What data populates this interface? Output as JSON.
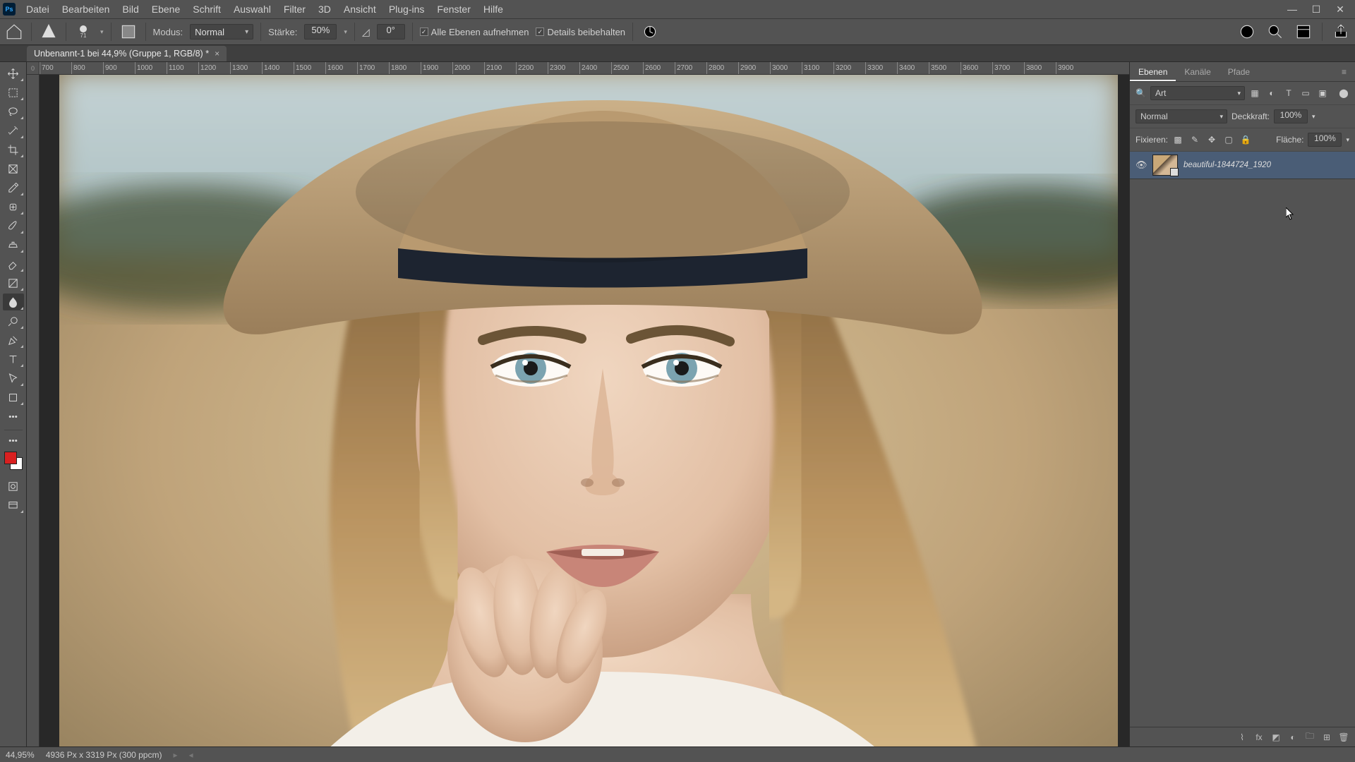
{
  "menubar": {
    "items": [
      "Datei",
      "Bearbeiten",
      "Bild",
      "Ebene",
      "Schrift",
      "Auswahl",
      "Filter",
      "3D",
      "Ansicht",
      "Plug-ins",
      "Fenster",
      "Hilfe"
    ]
  },
  "optbar": {
    "mode_label": "Modus:",
    "mode_value": "Normal",
    "strength_label": "Stärke:",
    "strength_value": "50%",
    "angle_label": "0°",
    "check1": "Alle Ebenen aufnehmen",
    "check2": "Details beibehalten",
    "brush_size": "71"
  },
  "doc_tab": {
    "title": "Unbenannt-1 bei 44,9% (Gruppe 1, RGB/8) *"
  },
  "ruler": {
    "ticks": [
      "700",
      "800",
      "900",
      "1000",
      "1100",
      "1200",
      "1300",
      "1400",
      "1500",
      "1600",
      "1700",
      "1800",
      "1900",
      "2000",
      "2100",
      "2200",
      "2300",
      "2400",
      "2500",
      "2600",
      "2700",
      "2800",
      "2900",
      "3000",
      "3100",
      "3200",
      "3300",
      "3400",
      "3500",
      "3600",
      "3700",
      "3800",
      "3900"
    ],
    "origin": "0"
  },
  "panels": {
    "tabs": [
      "Ebenen",
      "Kanäle",
      "Pfade"
    ],
    "search_label": "Art",
    "blend_mode": "Normal",
    "opacity_label": "Deckkraft:",
    "opacity_value": "100%",
    "lock_label": "Fixieren:",
    "fill_label": "Fläche:",
    "fill_value": "100%",
    "layer_name": "beautiful-1844724_1920"
  },
  "statusbar": {
    "zoom": "44,95%",
    "dims": "4936 Px x 3319 Px (300 ppcm)"
  },
  "colors": {
    "fg": "#d92020",
    "bg": "#ffffff"
  }
}
